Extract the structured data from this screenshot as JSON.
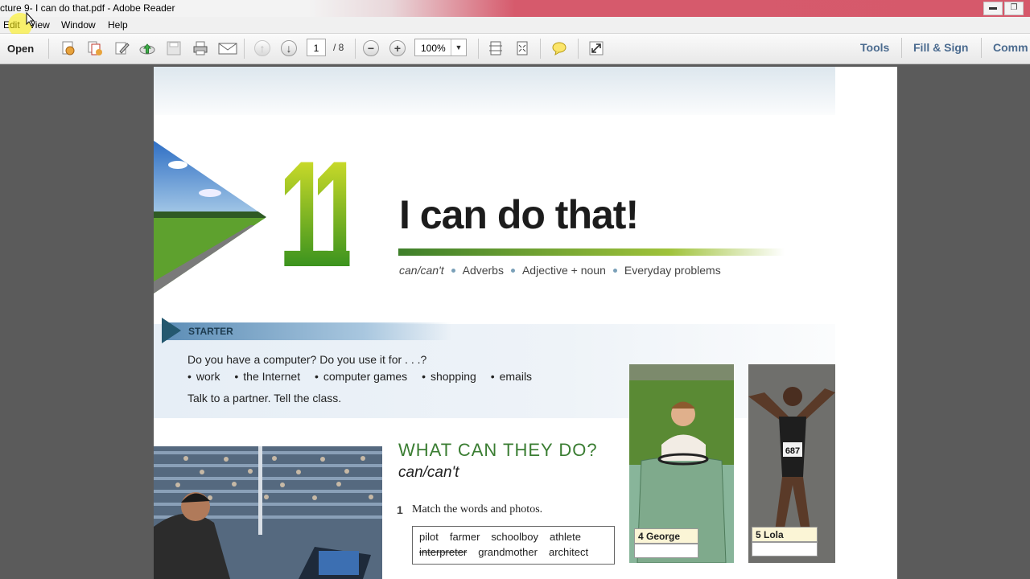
{
  "window": {
    "title": "cture 9- I can do that.pdf - Adobe Reader",
    "ghost_tabs": [
      "",
      "",
      "",
      ""
    ],
    "controls": [
      "minimize",
      "restore"
    ]
  },
  "menu": {
    "items": [
      "Edit",
      "View",
      "Window",
      "Help"
    ]
  },
  "toolbar": {
    "open_label": "Open",
    "icons": [
      "create-pdf-icon",
      "combine-files-icon",
      "edit-icon",
      "upload-cloud-icon",
      "save-icon",
      "print-icon",
      "email-icon",
      "prev-page-icon",
      "next-page-icon",
      "zoom-out-icon",
      "zoom-in-icon",
      "fit-page-icon",
      "fit-width-icon",
      "comment-icon",
      "fullscreen-icon"
    ],
    "page_current": "1",
    "page_total": "/ 8",
    "zoom": "100%",
    "right_links": [
      "Tools",
      "Fill & Sign",
      "Comm"
    ]
  },
  "document": {
    "unit_number": "11",
    "unit_title": "I can do that!",
    "topics": [
      "can/can't",
      "Adverbs",
      "Adjective + noun",
      "Everyday problems"
    ],
    "starter": {
      "label": "STARTER",
      "question": "Do you have a computer? Do you use it for . . .?",
      "items": [
        "work",
        "the Internet",
        "computer games",
        "shopping",
        "emails"
      ],
      "instruction": "Talk to a partner. Tell the class."
    },
    "section": {
      "title": "WHAT CAN THEY DO?",
      "subtitle": "can/can't",
      "exercise_number": "1",
      "exercise_text": "Match the words and photos.",
      "words_row1": [
        "pilot",
        "farmer",
        "schoolboy",
        "athlete"
      ],
      "words_row2": [
        "interpreter",
        "grandmother",
        "architect"
      ]
    },
    "captions": {
      "george": "4  George",
      "lola": "5  Lola",
      "bib": "687"
    },
    "colors": {
      "title_green": "#3a7d32",
      "link_blue": "#4b6b8f"
    }
  }
}
